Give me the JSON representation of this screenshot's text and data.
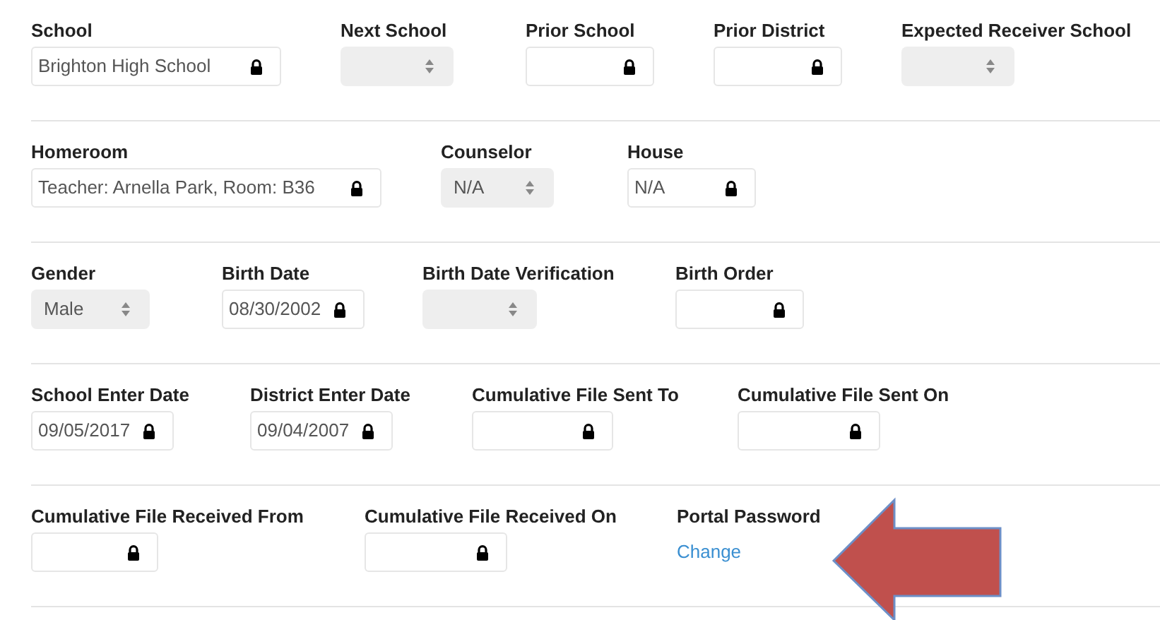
{
  "sections": [
    {
      "fields": [
        {
          "label": "School",
          "kind": "locked",
          "value": "Brighton High School"
        },
        {
          "label": "Next School",
          "kind": "select"
        },
        {
          "label": "Prior School",
          "kind": "locked"
        },
        {
          "label": "Prior District",
          "kind": "locked"
        },
        {
          "label": "Expected Receiver School",
          "kind": "select"
        }
      ]
    },
    {
      "fields": [
        {
          "label": "Homeroom",
          "kind": "locked",
          "value": "Teacher: Arnella Park, Room: B36"
        },
        {
          "label": "Counselor",
          "kind": "select",
          "value": "N/A"
        },
        {
          "label": "House",
          "kind": "locked",
          "value": "N/A"
        }
      ]
    },
    {
      "fields": [
        {
          "label": "Gender",
          "kind": "select",
          "value": "Male"
        },
        {
          "label": "Birth Date",
          "kind": "locked",
          "value": "08/30/2002"
        },
        {
          "label": "Birth Date Verification",
          "kind": "select"
        },
        {
          "label": "Birth Order",
          "kind": "locked"
        }
      ]
    },
    {
      "fields": [
        {
          "label": "School Enter Date",
          "kind": "locked",
          "value": "09/05/2017"
        },
        {
          "label": "District Enter Date",
          "kind": "locked",
          "value": "09/04/2007"
        },
        {
          "label": "Cumulative File Sent To",
          "kind": "locked"
        },
        {
          "label": "Cumulative File Sent On",
          "kind": "locked"
        }
      ]
    },
    {
      "fields": [
        {
          "label": "Cumulative File Received From",
          "kind": "locked"
        },
        {
          "label": "Cumulative File Received On",
          "kind": "locked"
        },
        {
          "label": "Portal Password",
          "kind": "link",
          "value": "Change"
        }
      ]
    }
  ]
}
